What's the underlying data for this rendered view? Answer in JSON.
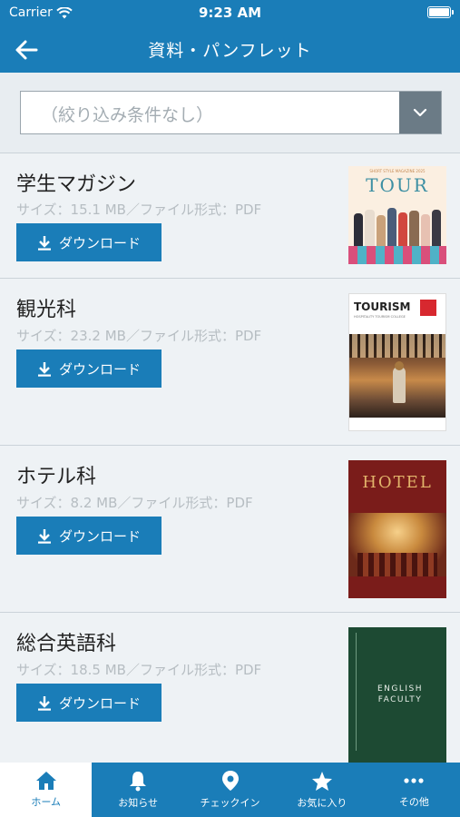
{
  "status": {
    "carrier": "Carrier",
    "time": "9:23 AM"
  },
  "nav": {
    "title": "資料・パンフレット"
  },
  "filter": {
    "value": "（絞り込み条件なし）"
  },
  "items": [
    {
      "name": "学生マガジン",
      "meta": "サイズ：15.1 MB／ファイル形式：PDF",
      "button": "ダウンロード",
      "cover_title": "TOUR",
      "cover_tagline": "SHORT STYLE MAGAZINE 2025"
    },
    {
      "name": "観光科",
      "meta": "サイズ：23.2 MB／ファイル形式：PDF",
      "button": "ダウンロード",
      "cover_title": "TOURISM",
      "cover_tagline": "HOSPITALITY TOURISM COLLEGE"
    },
    {
      "name": "ホテル科",
      "meta": "サイズ：8.2 MB／ファイル形式：PDF",
      "button": "ダウンロード",
      "cover_title": "HOTEL",
      "cover_tagline": ""
    },
    {
      "name": "総合英語科",
      "meta": "サイズ：18.5 MB／ファイル形式：PDF",
      "button": "ダウンロード",
      "cover_title": "ENGLISH FACULTY",
      "cover_tagline": ""
    }
  ],
  "tabs": [
    {
      "label": "ホーム",
      "icon": "home-icon",
      "active": true
    },
    {
      "label": "お知らせ",
      "icon": "bell-icon",
      "active": false
    },
    {
      "label": "チェックイン",
      "icon": "location-pin-icon",
      "active": false
    },
    {
      "label": "お気に入り",
      "icon": "star-icon",
      "active": false
    },
    {
      "label": "その他",
      "icon": "more-dots-icon",
      "active": false
    }
  ],
  "colors": {
    "primary": "#1a7db8",
    "background": "#e8edf1",
    "meta_text": "#b6bdc2"
  }
}
